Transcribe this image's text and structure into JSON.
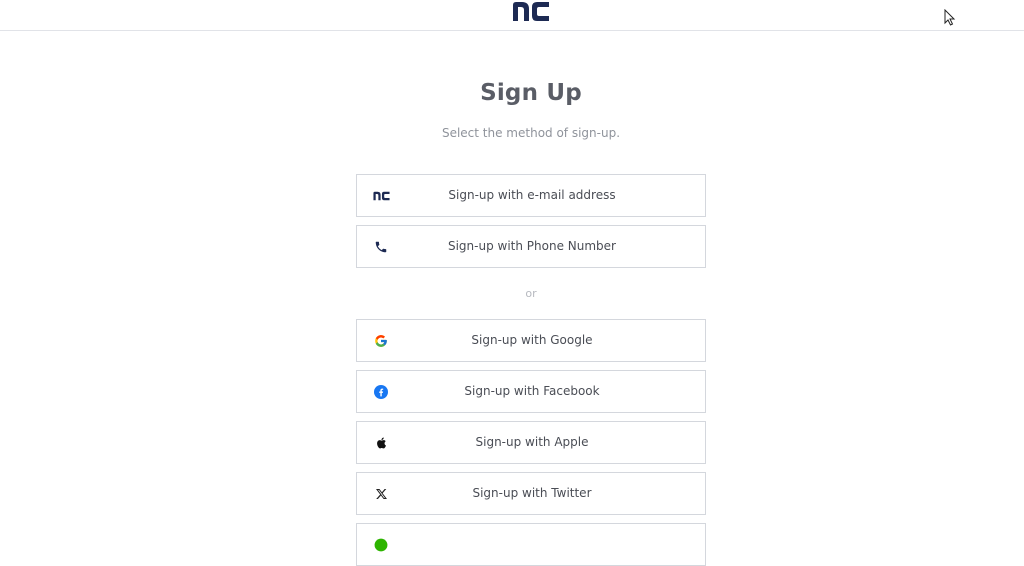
{
  "header": {
    "logo_icon": "nc-logo",
    "logo_color": "#1d2a53"
  },
  "main": {
    "title": "Sign Up",
    "subtitle": "Select the method of sign-up.",
    "primary_buttons": [
      {
        "label": "Sign-up with e-mail address",
        "icon": "nc-logo-icon"
      },
      {
        "label": "Sign-up with Phone Number",
        "icon": "phone-icon"
      }
    ],
    "divider_text": "or",
    "social_buttons": [
      {
        "label": "Sign-up with Google",
        "icon": "google-icon"
      },
      {
        "label": "Sign-up with Facebook",
        "icon": "facebook-icon"
      },
      {
        "label": "Sign-up with Apple",
        "icon": "apple-icon"
      },
      {
        "label": "Sign-up with Twitter",
        "icon": "x-twitter-icon"
      },
      {
        "label": "",
        "icon": "green-circle-icon"
      }
    ]
  },
  "colors": {
    "brand_navy": "#1d2a53",
    "facebook_blue": "#1877f2",
    "border": "#d4d7dd",
    "title_text": "#5a5d66",
    "subtle_text": "#8f939b"
  }
}
